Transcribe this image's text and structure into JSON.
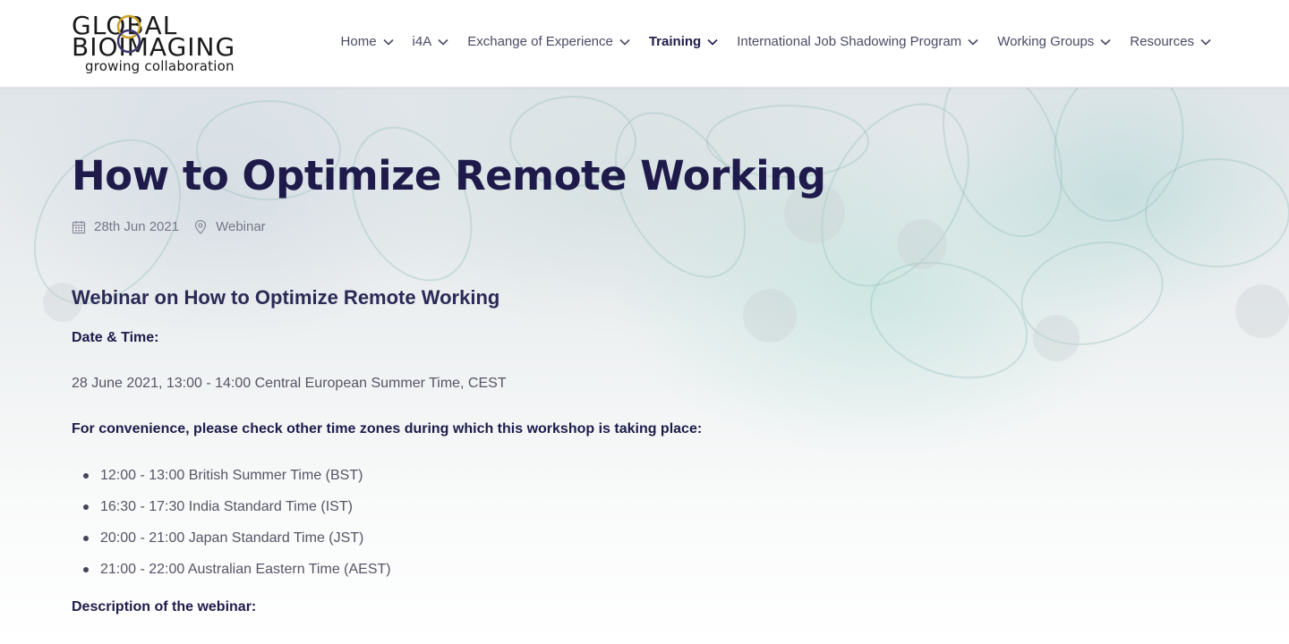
{
  "logo": {
    "line1": "GLOBAL",
    "line2": "BIOIMAGING",
    "tagline": "growing collaboration"
  },
  "nav": {
    "items": [
      {
        "label": "Home",
        "active": false
      },
      {
        "label": "i4A",
        "active": false
      },
      {
        "label": "Exchange of Experience",
        "active": false
      },
      {
        "label": "Training",
        "active": true
      },
      {
        "label": "International Job Shadowing Program",
        "active": false
      },
      {
        "label": "Working Groups",
        "active": false
      },
      {
        "label": "Resources",
        "active": false
      }
    ]
  },
  "page": {
    "title": "How to Optimize Remote Working",
    "date": "28th Jun 2021",
    "location": "Webinar",
    "subtitle": "Webinar on How to Optimize Remote Working",
    "datetime_label": "Date & Time:",
    "datetime_value": "28 June 2021, 13:00 - 14:00 Central European Summer Time, CEST",
    "timezones_label": "For convenience, please check other time zones during which this workshop is taking place:",
    "timezones": [
      "12:00 - 13:00 British Summer Time (BST)",
      "16:30 - 17:30 India Standard Time (IST)",
      "20:00 - 21:00 Japan Standard Time (JST)",
      "21:00 - 22:00 Australian Eastern Time (AEST)"
    ],
    "description_label": "Description of the webinar:"
  },
  "colors": {
    "heading": "#1e1b4b",
    "body_text": "#555566",
    "logo_accent": "#c9a227"
  }
}
